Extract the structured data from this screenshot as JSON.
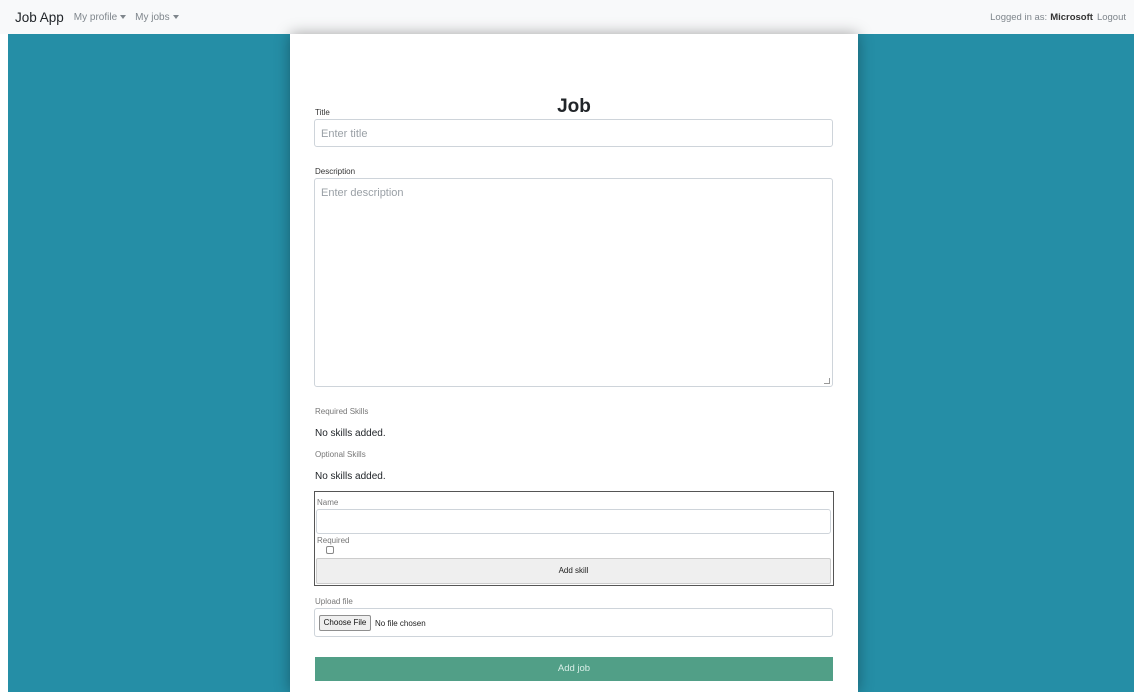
{
  "navbar": {
    "brand": "Job App",
    "menus": [
      {
        "label": "My profile"
      },
      {
        "label": "My jobs"
      }
    ],
    "logged_in_prefix": "Logged in as:",
    "username": "Microsoft",
    "logout": "Logout"
  },
  "form": {
    "heading": "Job",
    "title_label": "Title",
    "title_placeholder": "Enter title",
    "description_label": "Description",
    "description_placeholder": "Enter description",
    "required_skills_label": "Required Skills",
    "required_skills_empty": "No skills added.",
    "optional_skills_label": "Optional Skills",
    "optional_skills_empty": "No skills added.",
    "skill_name_label": "Name",
    "skill_required_label": "Required",
    "add_skill_button": "Add skill",
    "upload_label": "Upload file",
    "choose_file_button": "Choose File",
    "no_file_text": "No file chosen",
    "submit_button": "Add job"
  },
  "colors": {
    "background": "#258ea6",
    "submit": "#519f87"
  }
}
